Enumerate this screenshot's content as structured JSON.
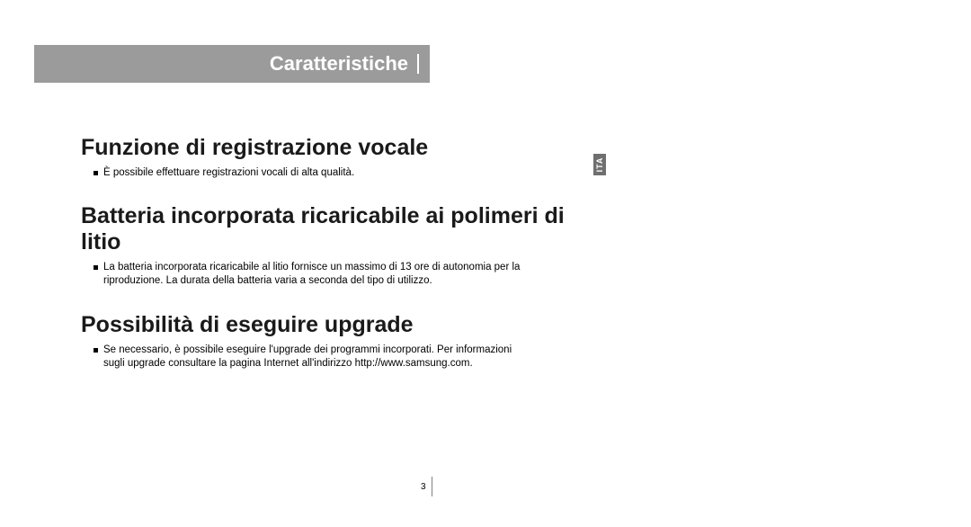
{
  "header": {
    "title": "Caratteristiche"
  },
  "lang_tab": "ITA",
  "sections": [
    {
      "title": "Funzione di registrazione vocale",
      "bullet": "È possibile effettuare registrazioni vocali di alta qualità."
    },
    {
      "title": "Batteria incorporata ricaricabile ai polimeri di litio",
      "bullet": "La batteria incorporata ricaricabile al litio fornisce un massimo di 13 ore di autonomia per la riproduzione. La durata della batteria varia a seconda del tipo di utilizzo."
    },
    {
      "title": "Possibilità di eseguire upgrade",
      "bullet": "Se necessario, è possibile eseguire l'upgrade dei programmi incorporati. Per informazioni sugli upgrade consultare la pagina Internet all'indirizzo http://www.samsung.com."
    }
  ],
  "page_number": "3"
}
